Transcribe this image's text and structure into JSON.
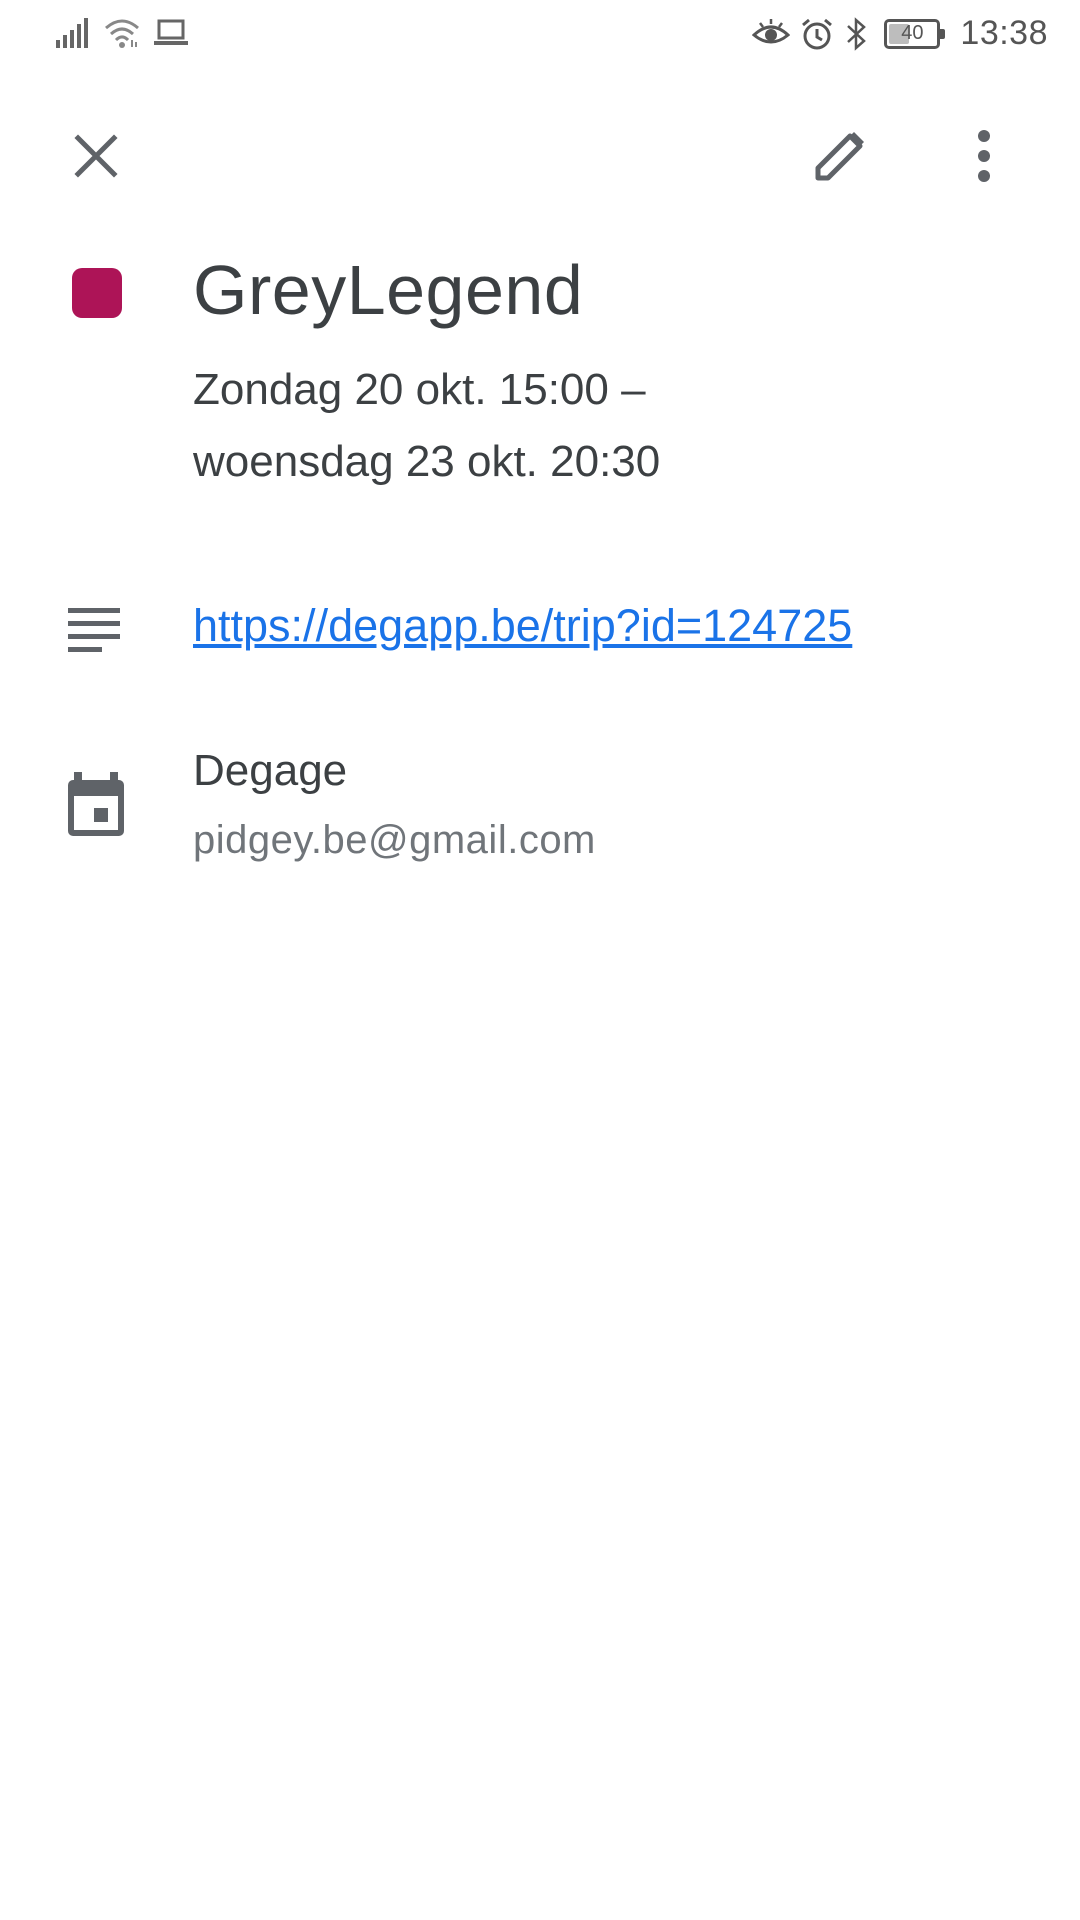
{
  "status_bar": {
    "time": "13:38",
    "battery_level": "40",
    "icons": [
      "signal-icon",
      "wifi-icon",
      "laptop-icon",
      "eye-comfort-icon",
      "alarm-icon",
      "bluetooth-icon",
      "battery-icon"
    ]
  },
  "app_bar": {
    "close_icon": "close-icon",
    "edit_icon": "pencil-icon",
    "more_icon": "more-vert-icon"
  },
  "event": {
    "color": "#ad1457",
    "title": "GreyLegend",
    "date_line1": "Zondag 20 okt. 15:00 –",
    "date_line2": "woensdag 23 okt. 20:30",
    "description_link": "https://degapp.be/trip?id=124725",
    "calendar_name": "Degage",
    "calendar_account": "pidgey.be@gmail.com"
  },
  "colors": {
    "link": "#1a73e8",
    "text_primary": "#3c4043",
    "text_secondary": "#70757a",
    "icon": "#5f6368"
  }
}
